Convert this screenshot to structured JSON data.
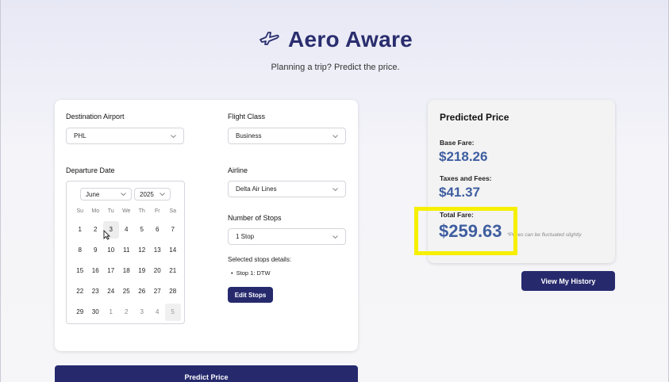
{
  "app": {
    "title": "Aero Aware",
    "subtitle": "Planning a trip? Predict the price."
  },
  "form": {
    "destination": {
      "label": "Destination Airport",
      "value": "PHL"
    },
    "flight_class": {
      "label": "Flight Class",
      "value": "Business"
    },
    "departure": {
      "label": "Departure Date",
      "month": "June",
      "year": "2025",
      "weekdays": [
        "Su",
        "Mo",
        "Tu",
        "We",
        "Th",
        "Fr",
        "Sa"
      ],
      "weeks": [
        [
          "1",
          "2",
          "3",
          "4",
          "5",
          "6",
          "7"
        ],
        [
          "8",
          "9",
          "10",
          "11",
          "12",
          "13",
          "14"
        ],
        [
          "15",
          "16",
          "17",
          "18",
          "19",
          "20",
          "21"
        ],
        [
          "22",
          "23",
          "24",
          "25",
          "26",
          "27",
          "28"
        ],
        [
          "29",
          "30",
          "1",
          "2",
          "3",
          "4",
          "5"
        ]
      ],
      "selected_day": "3"
    },
    "airline": {
      "label": "Airline",
      "value": "Delta Air Lines"
    },
    "stops": {
      "label": "Number of Stops",
      "value": "1 Stop"
    },
    "stops_details": {
      "title": "Selected stops details:",
      "items": [
        "Stop 1: DTW"
      ]
    },
    "edit_stops_label": "Edit Stops",
    "predict_label": "Predict Price"
  },
  "prediction": {
    "title": "Predicted Price",
    "base_fare_label": "Base Fare:",
    "base_fare": "$218.26",
    "taxes_label": "Taxes and Fees:",
    "taxes": "$41.37",
    "total_label": "Total Fare:",
    "total": "$259.63",
    "note": "*Prices can be fluctuated slightly",
    "history_label": "View My History"
  },
  "colors": {
    "brand": "#2a2d6e",
    "price": "#3f5ea0",
    "highlight": "#f7ef00"
  }
}
